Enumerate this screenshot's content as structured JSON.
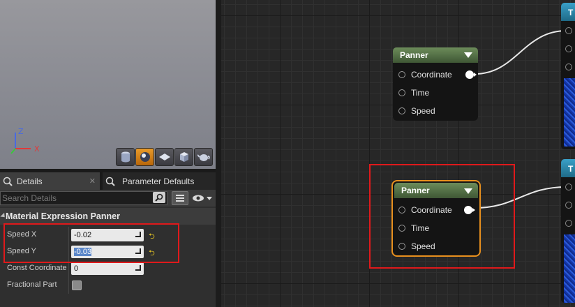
{
  "viewport": {
    "axis_z": "Z",
    "axis_x": "X",
    "buttons": [
      "cylinder-icon",
      "sphere-icon",
      "plane-icon",
      "cube-icon",
      "teapot-icon"
    ]
  },
  "details": {
    "tab_details": "Details",
    "tab_params": "Parameter Defaults",
    "search_placeholder": "Search Details",
    "section_title": "Material Expression Panner",
    "speed_x_label": "Speed X",
    "speed_x_value": "-0.02",
    "speed_y_label": "Speed Y",
    "speed_y_value": "-0.03",
    "const_coord_label": "Const Coordinate",
    "const_coord_value": "0",
    "fractional_label": "Fractional Part"
  },
  "graph": {
    "node1": {
      "title": "Panner",
      "pins": [
        "Coordinate",
        "Time",
        "Speed"
      ]
    },
    "node2": {
      "title": "Panner",
      "pins": [
        "Coordinate",
        "Time",
        "Speed"
      ]
    },
    "tex1_title": "T",
    "tex2_title": "T"
  },
  "colors": {
    "highlight": "#e0191b",
    "selected_node": "#e8901e",
    "node_header": "#55743f",
    "texture_header": "#2a86ad"
  }
}
